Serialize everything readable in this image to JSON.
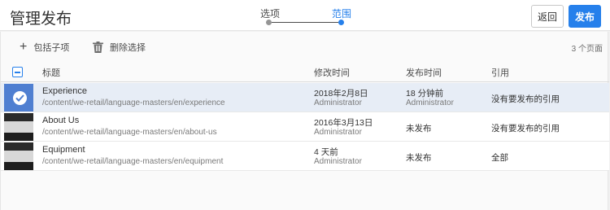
{
  "header": {
    "title": "管理发布",
    "steps": [
      {
        "label": "选项",
        "state": "done"
      },
      {
        "label": "范围",
        "state": "active"
      }
    ],
    "back_label": "返回",
    "publish_label": "发布",
    "accent_color": "#2680eb"
  },
  "toolbar": {
    "add_icon": "plus-icon",
    "add_label": "包括子项",
    "delete_icon": "trash-icon",
    "delete_label": "删除选择",
    "page_count": "3 个页面"
  },
  "table": {
    "columns": [
      "标题",
      "修改时间",
      "发布时间",
      "引用"
    ],
    "rows": [
      {
        "selected": true,
        "title": "Experience",
        "path": "/content/we-retail/language-masters/en/experience",
        "modified_date": "2018年2月8日",
        "modified_by": "Administrator",
        "published": "18 分钟前",
        "published_by": "Administrator",
        "references": "没有要发布的引用"
      },
      {
        "selected": false,
        "title": "About Us",
        "path": "/content/we-retail/language-masters/en/about-us",
        "modified_date": "2016年3月13日",
        "modified_by": "Administrator",
        "published": "未发布",
        "published_by": "",
        "references": "没有要发布的引用"
      },
      {
        "selected": false,
        "title": "Equipment",
        "path": "/content/we-retail/language-masters/en/equipment",
        "modified_date": "4 天前",
        "modified_by": "Administrator",
        "published": "未发布",
        "published_by": "",
        "references": "全部"
      }
    ]
  }
}
